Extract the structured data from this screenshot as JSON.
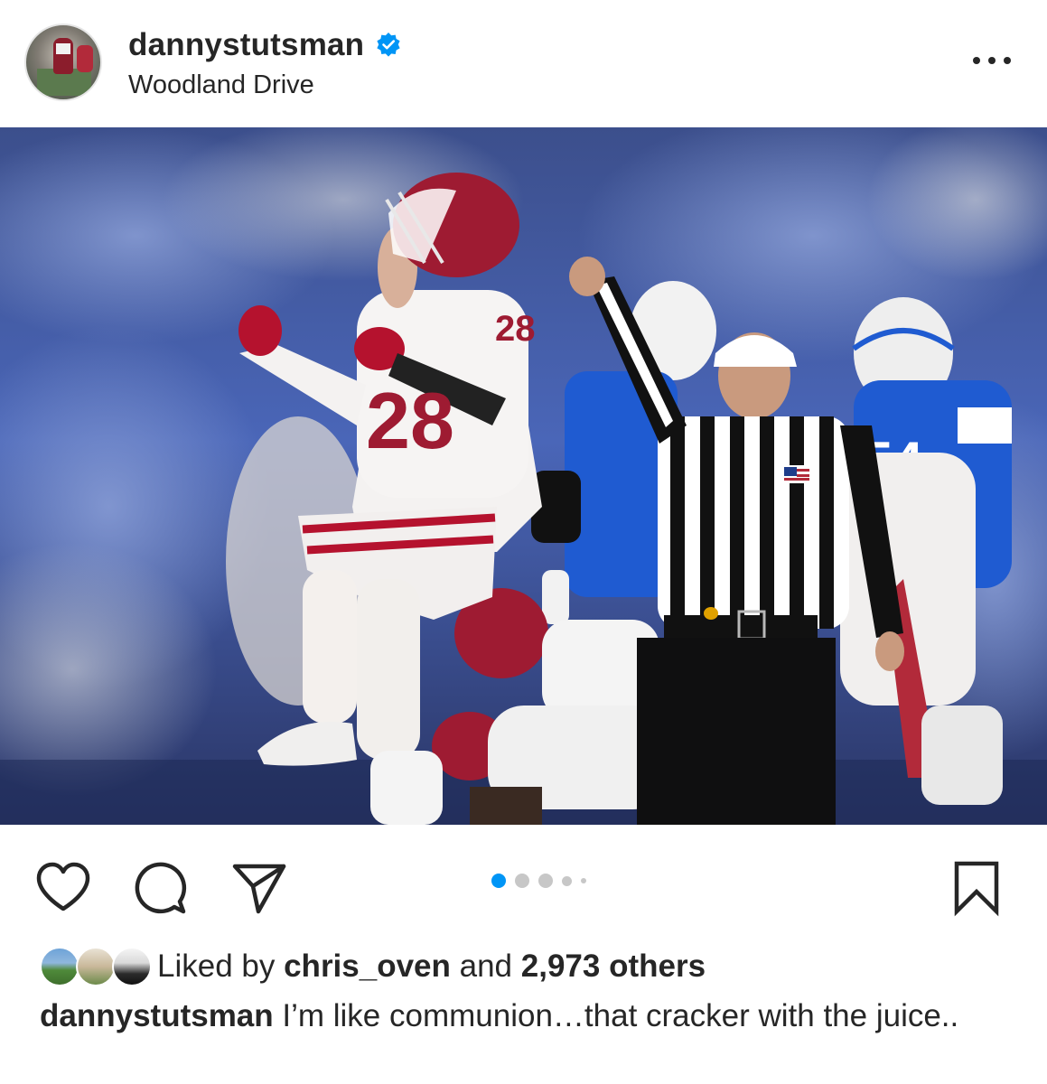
{
  "post": {
    "username": "dannystutsman",
    "location": "Woodland Drive",
    "verified": true
  },
  "icons": {
    "verified": "verified-badge-icon",
    "more": "more-options-icon",
    "like": "heart-icon",
    "comment": "comment-bubble-icon",
    "share": "paper-plane-icon",
    "save": "bookmark-icon"
  },
  "carousel": {
    "total_dots": 5,
    "active_index": 0,
    "active_color": "#0095f6",
    "inactive_color": "#c7c7c7"
  },
  "photo": {
    "jersey_number": "28",
    "opponent_jersey_number": "54"
  },
  "likes": {
    "prefix": "Liked by ",
    "user": "chris_oven",
    "middle": " and ",
    "count_text": "2,973 others"
  },
  "caption": {
    "username": "dannystutsman",
    "text": " I’m like communion…that cracker with the juice.."
  },
  "colors": {
    "verified_blue": "#0095f6",
    "text": "#262626",
    "crimson": "#9e1b32",
    "byu_blue": "#1f5bd1"
  }
}
